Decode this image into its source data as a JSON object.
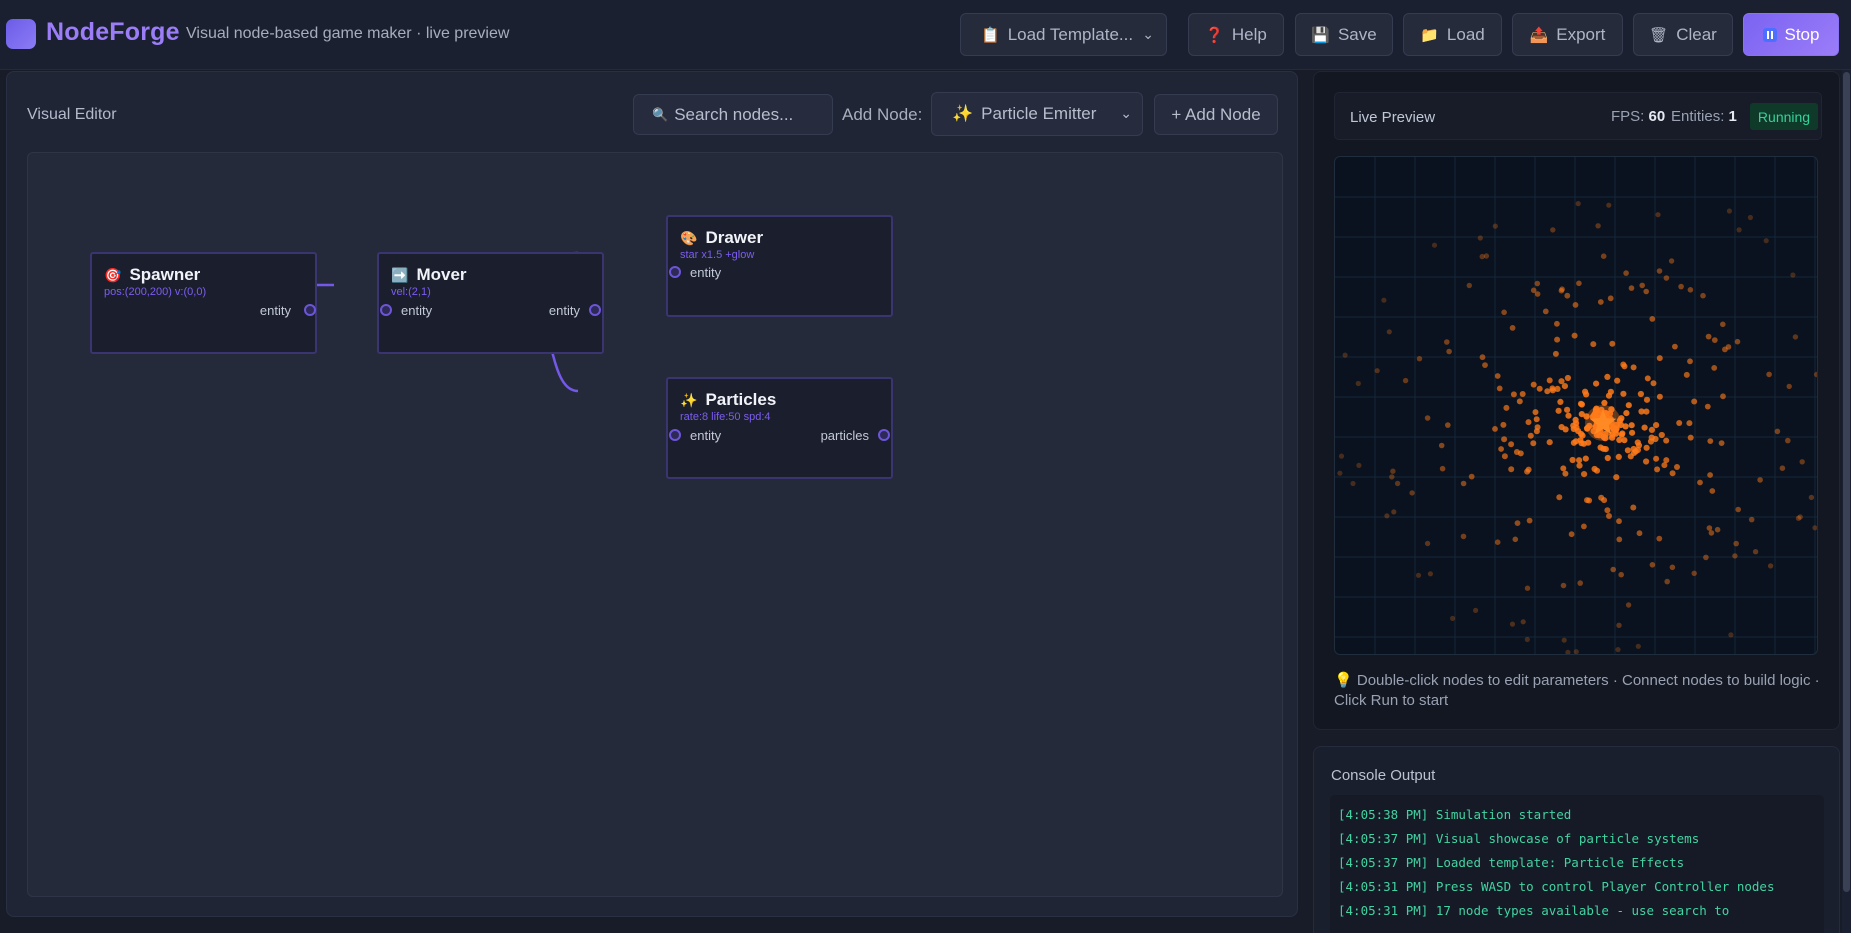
{
  "app": {
    "title": "NodeForge",
    "subtitle": "Visual node-based game maker · live preview"
  },
  "header": {
    "template_select": {
      "icon": "📋",
      "label": "Load Template..."
    },
    "buttons": [
      {
        "icon": "❓",
        "label": "Help"
      },
      {
        "icon": "💾",
        "label": "Save"
      },
      {
        "icon": "📁",
        "label": "Load"
      },
      {
        "icon": "📤",
        "label": "Export"
      },
      {
        "icon": "🗑",
        "label": "Clear"
      },
      {
        "icon": "pause-icon",
        "label": "Stop"
      }
    ]
  },
  "editor": {
    "label": "Visual Editor",
    "search_placeholder": "Search nodes...",
    "add_node_label": "Add Node:",
    "selected_node_type": {
      "icon": "✨",
      "label": "Particle Emitter"
    },
    "add_node_button": "+ Add Node",
    "nodes": [
      {
        "id": "spawner",
        "icon": "🎯",
        "title": "Spawner",
        "params": "pos:(200,200) v:(0,0)",
        "inputs": [],
        "outputs": [
          "entity"
        ]
      },
      {
        "id": "mover",
        "icon": "➡️",
        "title": "Mover",
        "params": "vel:(2,1)",
        "inputs": [
          "entity"
        ],
        "outputs": [
          "entity"
        ]
      },
      {
        "id": "drawer",
        "icon": "🎨",
        "title": "Drawer",
        "params": "star x1.5 +glow",
        "inputs": [
          "entity"
        ],
        "outputs": []
      },
      {
        "id": "particles",
        "icon": "✨",
        "title": "Particles",
        "params": "rate:8 life:50 spd:4",
        "inputs": [
          "entity"
        ],
        "outputs": [
          "particles"
        ]
      }
    ],
    "connections": [
      {
        "from": "spawner.entity",
        "to": "mover.entity"
      },
      {
        "from": "mover.entity",
        "to": "drawer.entity"
      },
      {
        "from": "mover.entity",
        "to": "particles.entity"
      }
    ]
  },
  "preview": {
    "title": "Live Preview",
    "fps_label": "FPS:",
    "fps_value": "60",
    "entities_label": "Entities:",
    "entities_value": "1",
    "status": "Running",
    "particle_color": "#ff7a1a",
    "hint_icon": "💡",
    "hint": "Double-click nodes to edit parameters · Connect nodes to build logic · Click Run to start"
  },
  "console": {
    "title": "Console Output",
    "lines": [
      "[4:05:38 PM] Simulation started",
      "[4:05:37 PM] Visual showcase of particle systems",
      "[4:05:37 PM] Loaded template: Particle Effects",
      "[4:05:31 PM] Press WASD to control Player Controller nodes",
      "[4:05:31 PM] 17 node types available - use search to"
    ]
  },
  "colors": {
    "accent": "#9b7df8",
    "wire": "#7459e8",
    "running": "#34d399",
    "console_text": "#43d3a1"
  }
}
